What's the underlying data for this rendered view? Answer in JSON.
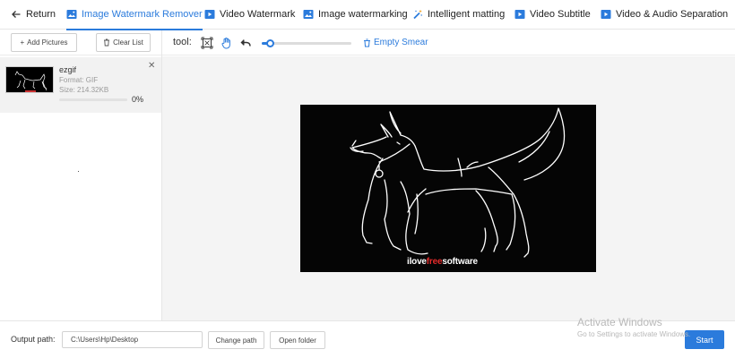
{
  "nav": {
    "return_label": "Return",
    "tabs": [
      {
        "label": "Image Watermark Remover",
        "active": true,
        "icon": "image-icon"
      },
      {
        "label": "Video Watermark",
        "active": false,
        "icon": "video-icon"
      },
      {
        "label": "Image watermarking",
        "active": false,
        "icon": "image-icon"
      },
      {
        "label": "Intelligent matting",
        "active": false,
        "icon": "magic-wand-icon"
      },
      {
        "label": "Video Subtitle",
        "active": false,
        "icon": "video-icon"
      },
      {
        "label": "Video & Audio Separation",
        "active": false,
        "icon": "video-icon"
      }
    ]
  },
  "sidebar": {
    "add_label": "Add Pictures",
    "clear_label": "Clear List",
    "file": {
      "name": "ezgif",
      "format": "Format:  GIF",
      "size": "Size:  214.32KB",
      "progress_pct": 0,
      "progress_label": "0%"
    }
  },
  "tools": {
    "label": "tool:",
    "slider_value": 0.1,
    "empty_smear_label": "Empty Smear"
  },
  "preview": {
    "watermark_pre": "ilove",
    "watermark_mid": "free",
    "watermark_post": "software"
  },
  "footer": {
    "output_label": "Output path:",
    "output_value": "C:\\Users\\Hp\\Desktop",
    "change_label": "Change path",
    "open_label": "Open folder",
    "start_label": "Start"
  },
  "overlay": {
    "activate_title": "Activate Windows",
    "activate_sub": "Go to Settings to activate Windows."
  },
  "colors": {
    "accent": "#2b7bdc",
    "watermark_red": "#e52b2b"
  }
}
